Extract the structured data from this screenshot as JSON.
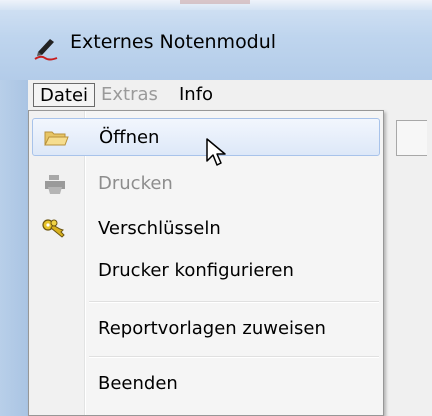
{
  "window": {
    "title": "Externes Notenmodul",
    "icon": "pen-signature-icon"
  },
  "menubar": {
    "items": [
      {
        "label": "Datei",
        "state": "open"
      },
      {
        "label": "Extras",
        "state": "disabled"
      },
      {
        "label": "Info",
        "state": "normal"
      }
    ]
  },
  "dropdown": {
    "items": [
      {
        "label": "Öffnen",
        "icon": "folder-open-icon",
        "state": "highlighted"
      },
      {
        "label": "Drucken",
        "icon": "printer-icon",
        "state": "disabled"
      },
      {
        "label": "Verschlüsseln",
        "icon": "keys-icon",
        "state": "normal"
      },
      {
        "label": "Drucker konfigurieren",
        "icon": "",
        "state": "normal"
      },
      {
        "label": "Reportvorlagen zuweisen",
        "icon": "",
        "state": "normal"
      },
      {
        "label": "Beenden",
        "icon": "",
        "state": "normal"
      }
    ]
  },
  "colors": {
    "highlight_border": "#a8c3ea",
    "disabled_text": "#8d8d8d",
    "titlebar": "#bfd5ee"
  }
}
